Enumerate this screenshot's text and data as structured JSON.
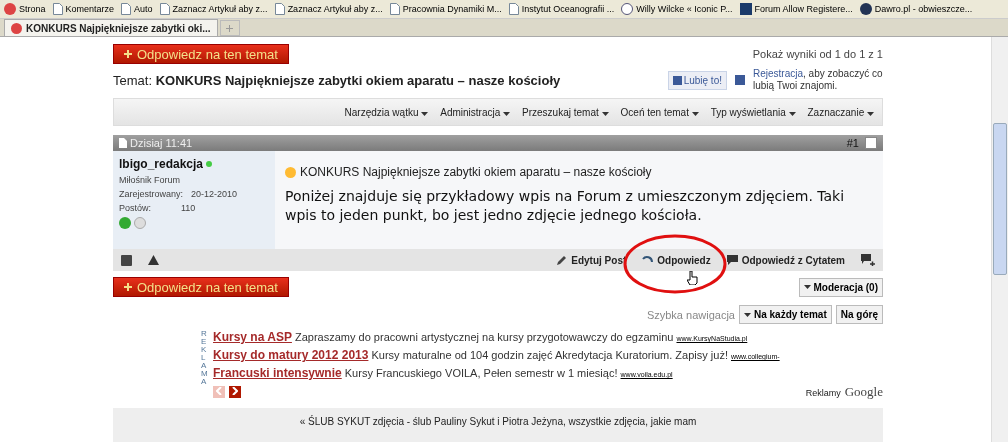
{
  "bookmarks": [
    {
      "label": "Strona",
      "kind": "site"
    },
    {
      "label": "Komentarze",
      "kind": "page"
    },
    {
      "label": "Auto",
      "kind": "page"
    },
    {
      "label": "Zaznacz Artykuł aby z...",
      "kind": "page"
    },
    {
      "label": "Zaznacz Artykuł aby z...",
      "kind": "page"
    },
    {
      "label": "Pracownia Dynamiki M...",
      "kind": "page"
    },
    {
      "label": "Instytut Oceanografii ...",
      "kind": "page"
    },
    {
      "label": "Willy Wilcke « Iconic P...",
      "kind": "wp"
    },
    {
      "label": "Forum Allow Registere...",
      "kind": "forum"
    },
    {
      "label": "Dawro.pl - obwieszcze...",
      "kind": "globe"
    }
  ],
  "tabs": [
    {
      "label": "KONKURS Najpiękniejsze zabytki oki...",
      "selected": true
    }
  ],
  "reply_buttons": [
    "Odpowiedz na ten temat",
    "Odpowiedz na ten temat"
  ],
  "pagination": "Pokaż wyniki od 1 do 1 z 1",
  "thread_title": {
    "prefix": "Temat:",
    "text": "KONKURS Najpiękniejsze zabytki okiem aparatu – nasze kościoły"
  },
  "like_button": "Lubię to!",
  "facebook_note": {
    "link": "Rejestracja",
    "text": ", aby zobaczyć co lubią Twoi znajomi."
  },
  "thread_tools": [
    "Narzędzia wątku",
    "Administracja",
    "Przeszukaj temat",
    "Oceń ten temat",
    "Typ wyświetlania",
    "Zaznaczanie"
  ],
  "post": {
    "date": "Dzisiaj 11:41",
    "number": "#1",
    "checked": false,
    "author": "lbigo_redakcja",
    "online": true,
    "rank": "Miłośnik Forum",
    "registered_label": "Zarejestrowany:",
    "registered_value": "20-12-2010",
    "posts_label": "Postów:",
    "posts_value": "110",
    "title": "KONKURS Najpiękniejsze zabytki okiem aparatu – nasze kościoły",
    "body": "Poniżej znajduje się przykładowy wpis na Forum z umieszczonym zdjęciem. Taki wpis to jeden punkt, bo jest jedno zdjęcie jednego kościoła.",
    "actions": [
      {
        "label": "Edytuj Post",
        "kind": "edit"
      },
      {
        "label": "Odpowiedz",
        "kind": "reply"
      },
      {
        "label": "Odpowiedź z Cytatem",
        "kind": "quote"
      },
      {
        "kind": "multiquote"
      }
    ]
  },
  "moderation": "Moderacja (0)",
  "quick_nav": {
    "label": "Szybka nawigacja",
    "select": "Na każdy temat",
    "top": "Na górę"
  },
  "ads_label": "REKLAMA",
  "ads": [
    {
      "title": "Kursy na ASP",
      "text": "Zapraszamy do pracowni artystycznej na kursy przygotowawczy do egzaminu",
      "url": "www.KursyNaStudia.pl"
    },
    {
      "title": "Kursy do matury 2012 2013",
      "text": "Kursy maturalne od 104 godzin zajęć Akredytacja Kuratorium. Zapisy już!",
      "url": "www.collegium-"
    },
    {
      "title": "Francuski intensywnie",
      "text": "Kursy Francuskiego VOILA, Pełen semestr w 1 miesiąc!",
      "url": "www.voila.edu.pl"
    }
  ],
  "ads_footer": {
    "label": "Reklamy",
    "brand": "Google"
  },
  "footer_link": "« ŚLUB SYKUT zdjęcia - ślub Pauliny Sykut i Piotra Jeżyna, wszystkie zdjęcia, jakie mam"
}
